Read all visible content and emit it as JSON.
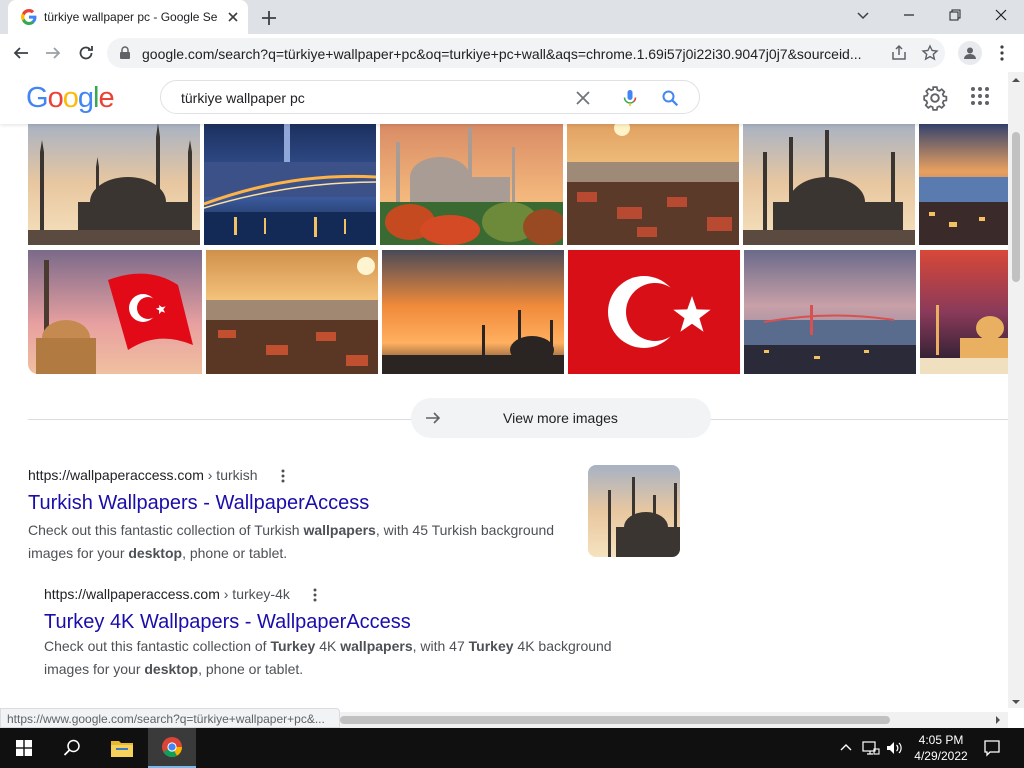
{
  "browser": {
    "tab_title": "türkiye wallpaper pc - Google Se",
    "url": "google.com/search?q=türkiye+wallpaper+pc&oq=turkiye+pc+wall&aqs=chrome.1.69i57j0i22i30.9047j0j7&sourceid..."
  },
  "header": {
    "logo_letters": [
      "G",
      "o",
      "o",
      "g",
      "l",
      "e"
    ],
    "query": "türkiye wallpaper pc"
  },
  "images": {
    "more_label": "View more images"
  },
  "results": [
    {
      "cite_domain": "https://wallpaperaccess.com",
      "cite_path": " › turkish",
      "title": "Turkish Wallpapers - WallpaperAccess",
      "snippet_line1_a": "Check out this fantastic collection of Turkish ",
      "snippet_line1_b": "wallpapers",
      "snippet_line1_c": ", with 45 Turkish background",
      "snippet_line2_a": "images for your ",
      "snippet_line2_b": "desktop",
      "snippet_line2_c": ", phone or tablet."
    },
    {
      "cite_domain": "https://wallpaperaccess.com",
      "cite_path": " › turkey-4k",
      "title": "Turkey 4K Wallpapers - WallpaperAccess",
      "snippet_line1_a": "Check out this fantastic collection of ",
      "snippet_line1_b": "Turkey",
      "snippet_line1_c": " 4K ",
      "snippet_line1_d": "wallpapers",
      "snippet_line1_e": ", with 47 ",
      "snippet_line1_f": "Turkey",
      "snippet_line1_g": " 4K background",
      "snippet_line2_a": "images for your ",
      "snippet_line2_b": "desktop",
      "snippet_line2_c": ", phone or tablet."
    }
  ],
  "status_url": "https://www.google.com/search?q=türkiye+wallpaper+pc&...",
  "taskbar": {
    "time": "4:05 PM",
    "date": "4/29/2022"
  },
  "colors": {
    "google_blue": "#4285f4",
    "google_red": "#ea4335",
    "google_yellow": "#fbbc05",
    "google_green": "#34a853",
    "link": "#1a0dab",
    "flag_red": "#e30a17"
  }
}
